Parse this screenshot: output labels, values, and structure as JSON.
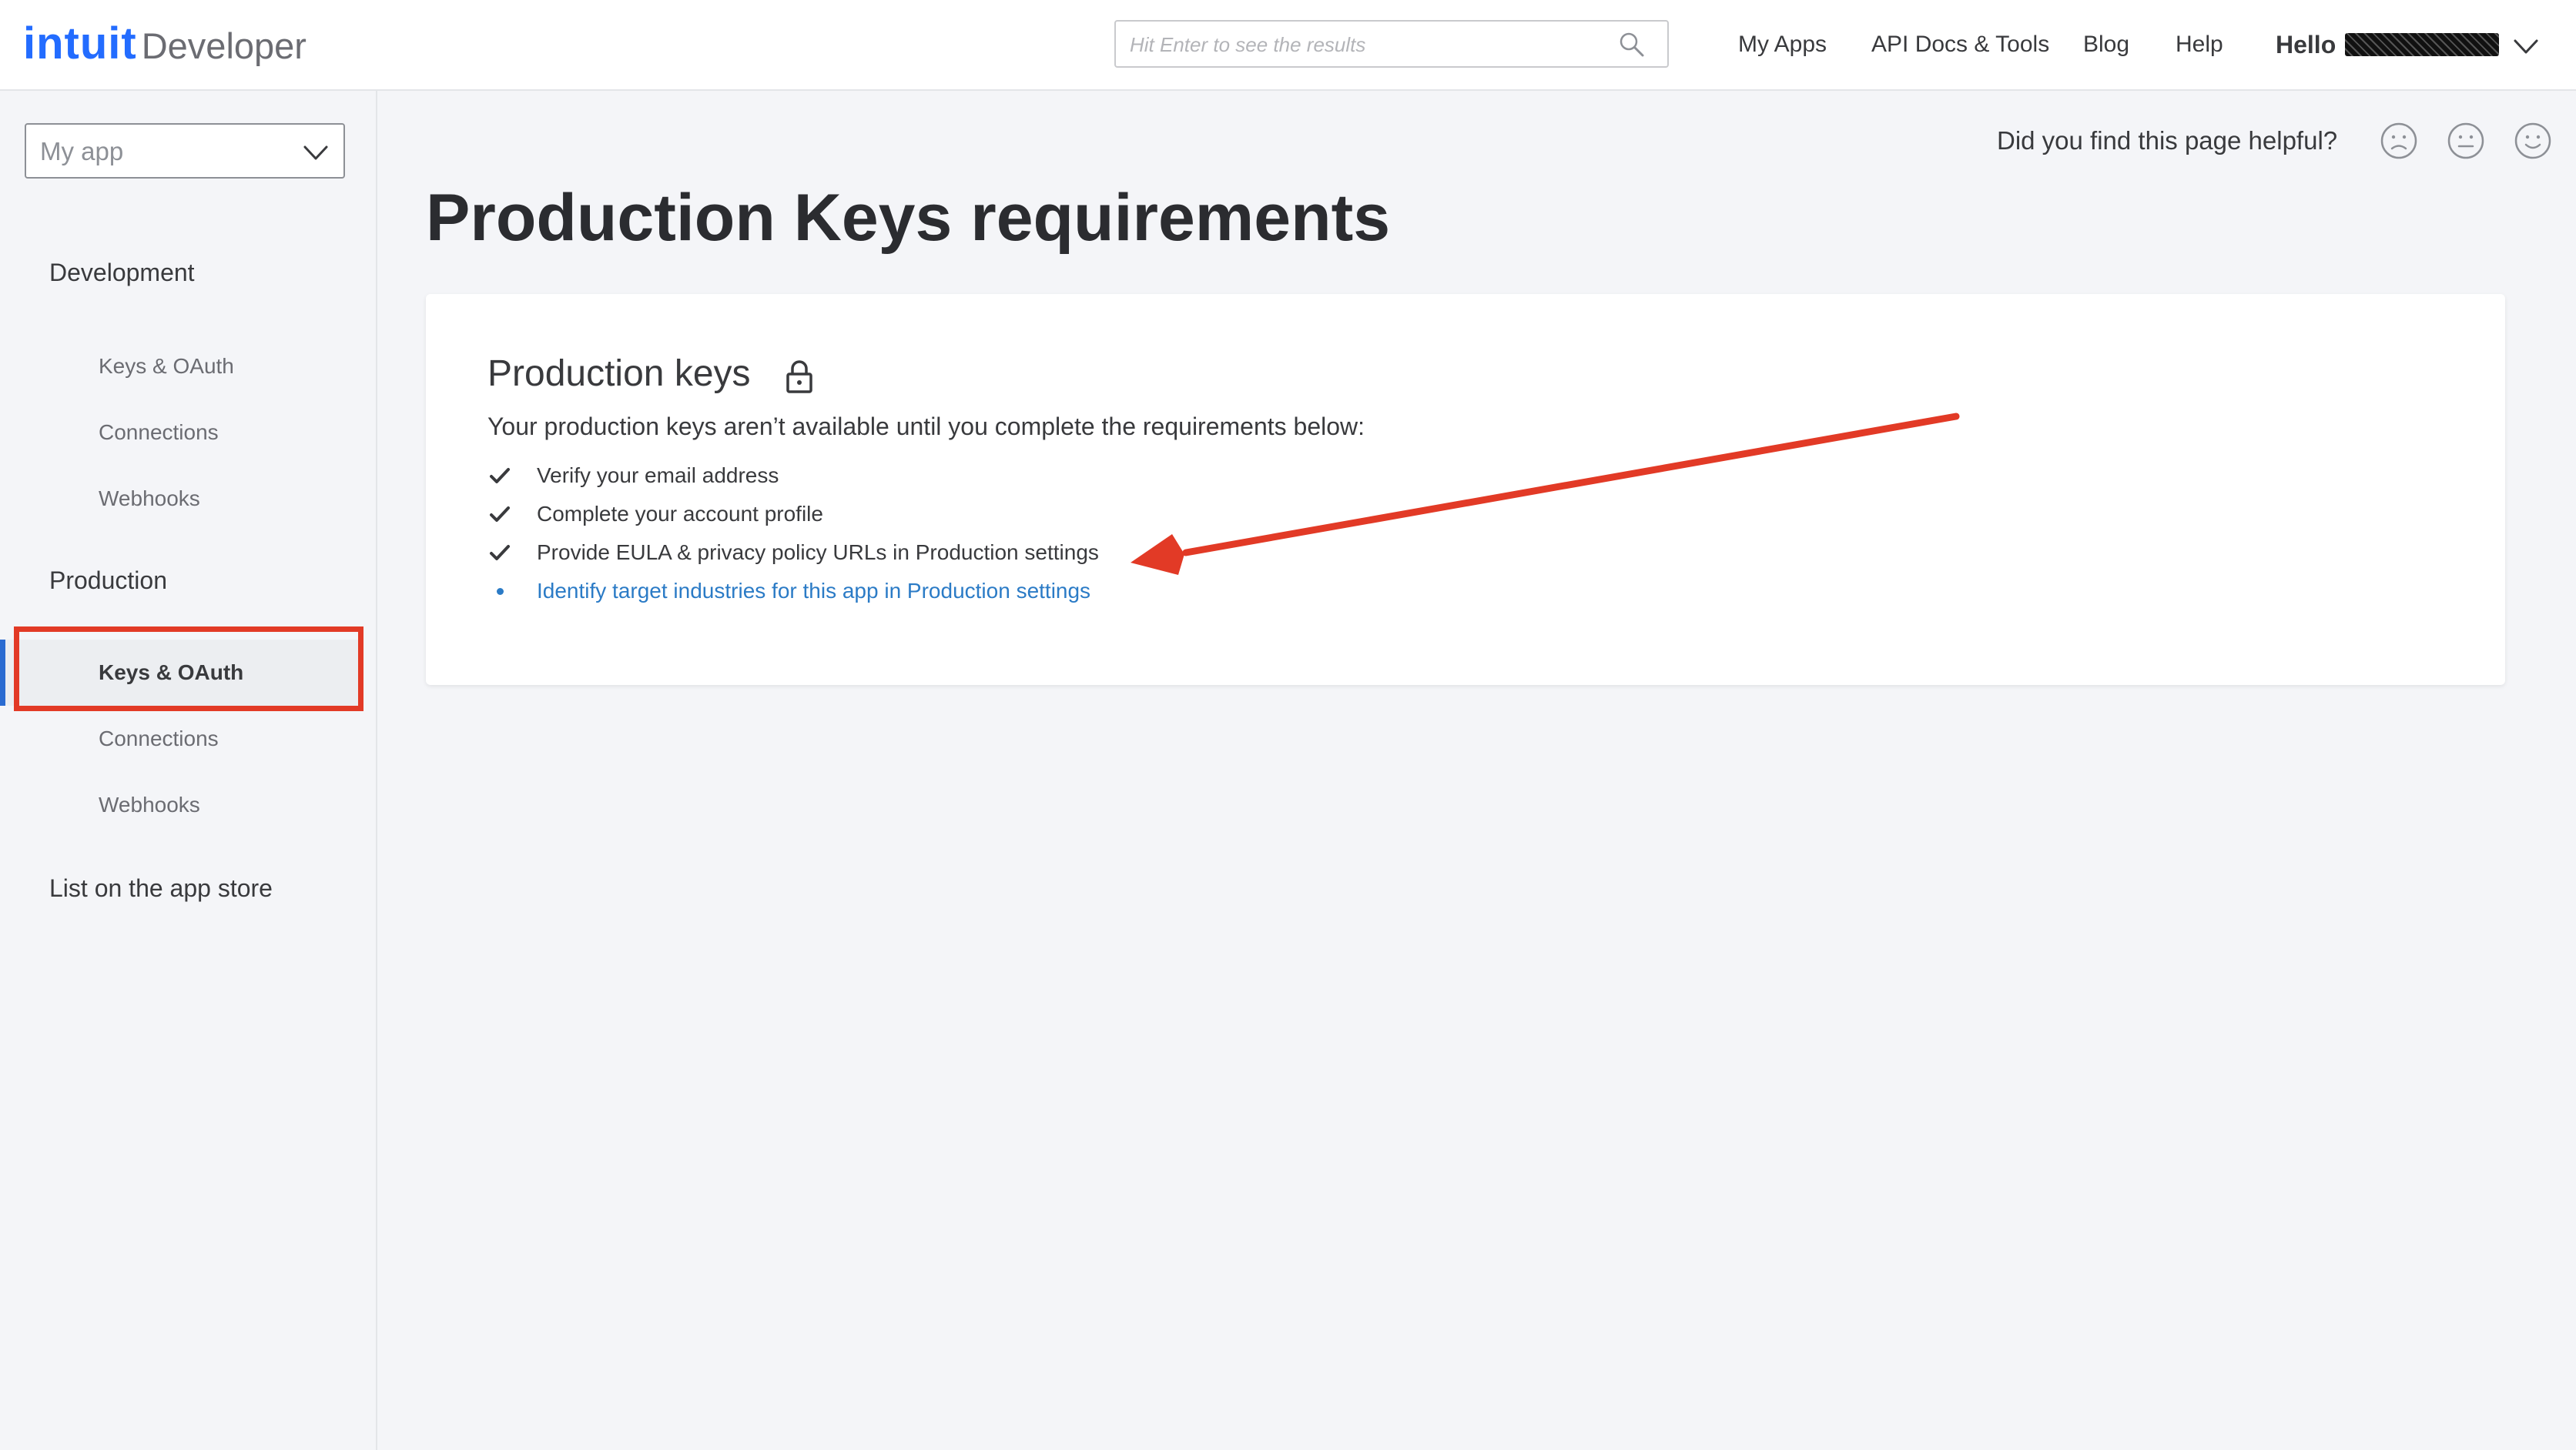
{
  "header": {
    "logo_intuit": "intuit",
    "logo_developer": "Developer",
    "search_placeholder": "Hit Enter to see the results",
    "nav": [
      "My Apps",
      "API Docs & Tools",
      "Blog",
      "Help"
    ],
    "greeting": "Hello"
  },
  "sidebar": {
    "app_select": "My app",
    "sections": [
      {
        "label": "Development",
        "items": [
          "Keys & OAuth",
          "Connections",
          "Webhooks"
        ]
      },
      {
        "label": "Production",
        "items": [
          "Keys & OAuth",
          "Connections",
          "Webhooks"
        ]
      },
      {
        "label": "List on the app store",
        "items": []
      }
    ],
    "active_item": "Production / Keys & OAuth"
  },
  "main": {
    "feedback_question": "Did you find this page helpful?",
    "page_title": "Production Keys requirements",
    "card": {
      "title": "Production keys",
      "description": "Your production keys aren’t available until you complete the requirements below:",
      "requirements": [
        {
          "text": "Verify your email address",
          "done": true
        },
        {
          "text": "Complete your account profile",
          "done": true
        },
        {
          "text": "Provide EULA & privacy policy URLs in Production settings",
          "done": true
        },
        {
          "text": "Identify target industries for this app in Production settings",
          "done": false
        }
      ]
    }
  },
  "icons": {
    "search": "search-icon",
    "user_menu": "chevron-down-icon",
    "app_select": "chevron-down-icon",
    "feedback": [
      "sad-face-icon",
      "neutral-face-icon",
      "happy-face-icon"
    ],
    "lock": "lock-icon",
    "check": "checkmark-icon",
    "bullet": "bullet-icon"
  },
  "colors": {
    "brand_blue": "#236cff",
    "link_blue": "#2b7bc6",
    "active_bar": "#2a6bd1",
    "annotation_red": "#e23a26",
    "background": "#f4f5f8"
  }
}
